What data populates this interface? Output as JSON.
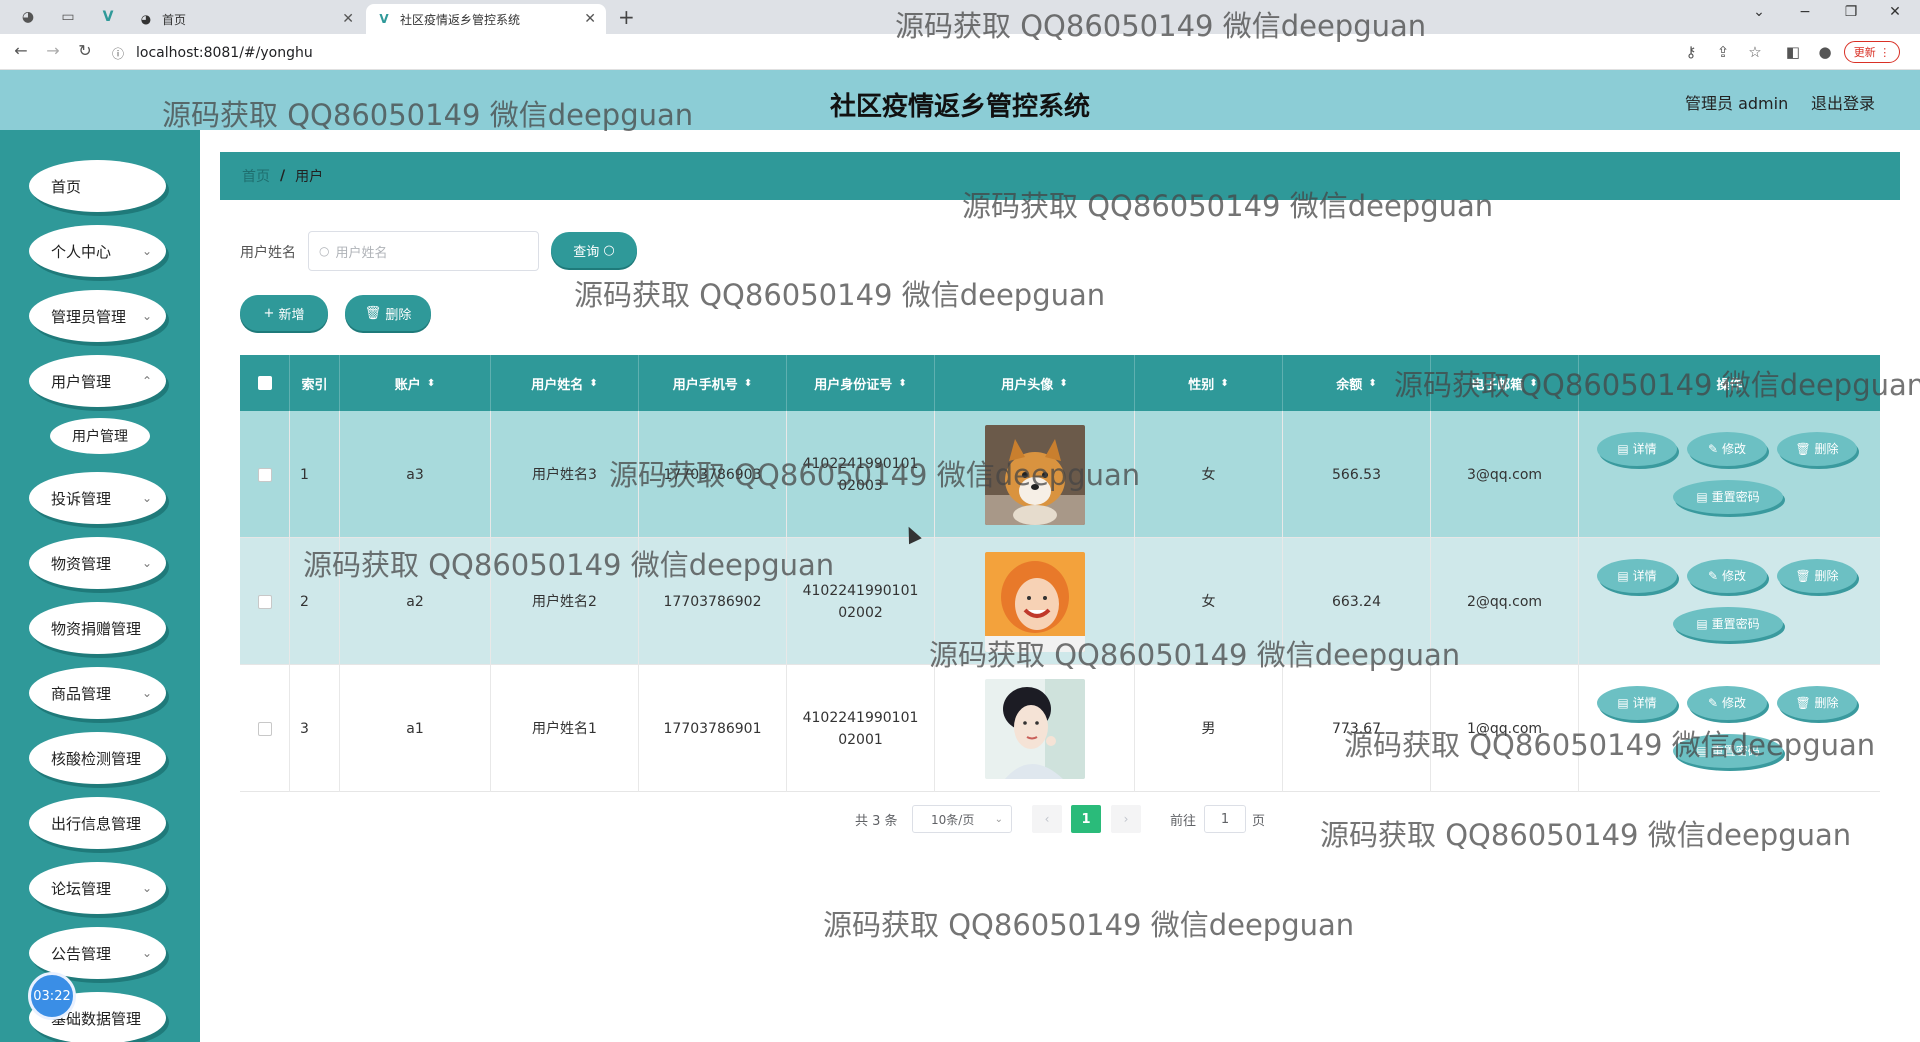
{
  "browser": {
    "tabs": [
      {
        "title": "首页",
        "active": false
      },
      {
        "title": "社区疫情返乡管控系统",
        "active": true
      }
    ],
    "url": "localhost:8081/#/yonghu",
    "update_label": "更新"
  },
  "header": {
    "title": "社区疫情返乡管控系统",
    "admin_label": "管理员 admin",
    "logout_label": "退出登录"
  },
  "sidebar": {
    "items": [
      {
        "label": "首页",
        "has_children": false
      },
      {
        "label": "个人中心",
        "has_children": true
      },
      {
        "label": "管理员管理",
        "has_children": true
      },
      {
        "label": "用户管理",
        "has_children": true
      },
      {
        "label": "投诉管理",
        "has_children": true
      },
      {
        "label": "物资管理",
        "has_children": true
      },
      {
        "label": "物资捐赠管理",
        "has_children": false
      },
      {
        "label": "商品管理",
        "has_children": true
      },
      {
        "label": "核酸检测管理",
        "has_children": false
      },
      {
        "label": "出行信息管理",
        "has_children": false
      },
      {
        "label": "论坛管理",
        "has_children": true
      },
      {
        "label": "公告管理",
        "has_children": true
      },
      {
        "label": "基础数据管理",
        "has_children": false
      }
    ],
    "subitem": "用户管理",
    "timer": "03:22"
  },
  "breadcrumb": {
    "home": "首页",
    "separator": "/",
    "current": "用户"
  },
  "search": {
    "label": "用户姓名",
    "placeholder": "用户姓名",
    "query_button": "查询"
  },
  "actions": {
    "add": "新增",
    "delete": "删除"
  },
  "table": {
    "columns": [
      "索引",
      "账户",
      "用户姓名",
      "用户手机号",
      "用户身份证号",
      "用户头像",
      "性别",
      "余额",
      "电子邮箱",
      "操作"
    ],
    "rows": [
      {
        "index": "1",
        "account": "a3",
        "name": "用户姓名3",
        "phone": "17703786903",
        "idcard": "410224199010102003",
        "gender": "女",
        "balance": "566.53",
        "email": "3@qq.com"
      },
      {
        "index": "2",
        "account": "a2",
        "name": "用户姓名2",
        "phone": "17703786902",
        "idcard": "410224199010102002",
        "gender": "女",
        "balance": "663.24",
        "email": "2@qq.com"
      },
      {
        "index": "3",
        "account": "a1",
        "name": "用户姓名1",
        "phone": "17703786901",
        "idcard": "410224199010102001",
        "gender": "男",
        "balance": "773.67",
        "email": "1@qq.com"
      }
    ],
    "row_actions": {
      "detail": "详情",
      "edit": "修改",
      "delete": "删除",
      "reset": "重置密码"
    }
  },
  "pagination": {
    "total": "共 3 条",
    "page_size": "10条/页",
    "current": "1",
    "goto_prefix": "前往",
    "goto_value": "1",
    "goto_suffix": "页"
  },
  "watermark": "源码获取 QQ86050149 微信deepguan"
}
